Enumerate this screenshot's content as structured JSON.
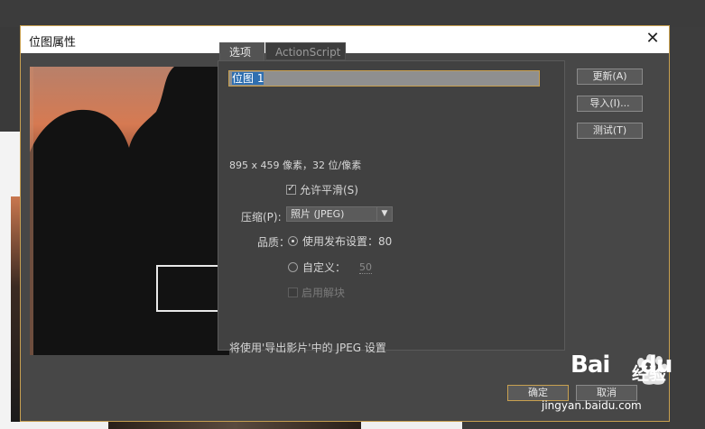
{
  "dialog": {
    "title": "位图属性",
    "close_glyph": "✕"
  },
  "tabs": {
    "options": "选项",
    "actionscript": "ActionScript"
  },
  "name_field": {
    "value_highlight": "位图 1"
  },
  "info": "895 x 459 像素，32 位/像素",
  "smoothing": {
    "label": "允许平滑(S)",
    "checked": true
  },
  "compression": {
    "label": "压缩(P):",
    "value": "照片 (JPEG)",
    "icon": "chevron-down-icon"
  },
  "quality": {
    "label": "品质：",
    "publish_label": "使用发布设置：80",
    "custom_label": "自定义：",
    "custom_value": "50"
  },
  "deblock": {
    "label": "启用解块",
    "checked": false,
    "disabled": true
  },
  "footer_note": "将使用'导出影片'中的 JPEG 设置",
  "buttons": {
    "update": "更新(A)",
    "import": "导入(I)...",
    "test": "测试(T)",
    "ok": "确定",
    "cancel": "取消"
  },
  "watermark": {
    "brand": "Bai",
    "brand2": "du",
    "cn": "经验",
    "url": "jingyan.baidu.com"
  },
  "colors": {
    "accent_border": "#c8a050",
    "dialog_bg": "#474747",
    "selection": "#2f6fb0"
  }
}
